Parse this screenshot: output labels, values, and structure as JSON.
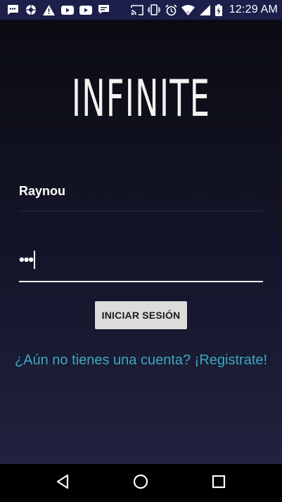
{
  "status_bar": {
    "time": "12:29 AM",
    "notification_icons": [
      "messages-icon",
      "camera-aperture-icon",
      "warning-icon",
      "youtube-icon",
      "youtube-icon",
      "chat-icon"
    ],
    "system_icons": [
      "cast-icon",
      "vibrate-icon",
      "alarm-icon",
      "wifi-icon",
      "cell-signal-icon",
      "battery-charging-icon"
    ],
    "background_color": "#1c1f4a"
  },
  "app": {
    "logo_text": "INFINITE"
  },
  "login_form": {
    "username_value": "Raynou",
    "password_value": "•••",
    "submit_label": "INICIAR SESIÓN",
    "register_link": "¿Aún no tienes una cuenta? ¡Registrate!"
  },
  "colors": {
    "link": "#3fa7c0",
    "button_bg": "#dcdcdc",
    "background_top": "#0b0c12",
    "background_bottom": "#22223f"
  },
  "nav_bar": {
    "buttons": [
      "back-icon",
      "home-icon",
      "recent-apps-icon"
    ]
  }
}
